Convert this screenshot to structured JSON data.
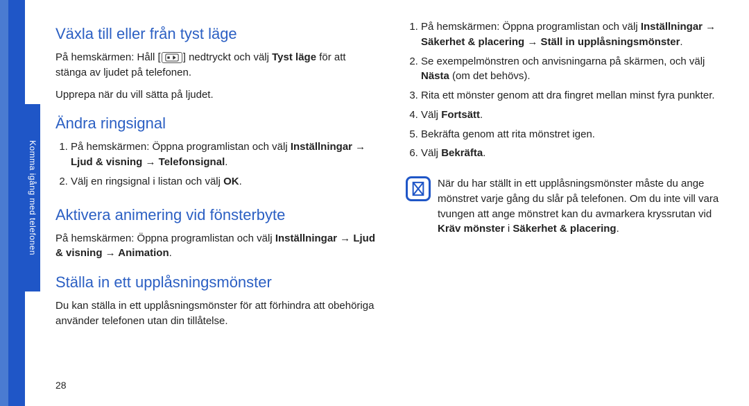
{
  "sidebar": {
    "label": "Komma igång med telefonen"
  },
  "page_number": "28",
  "col1": {
    "h1": "Växla till eller från tyst läge",
    "p1_a": "På hemskärmen: Håll [",
    "p1_b": "] nedtryckt och välj ",
    "p1_bold": "Tyst läge",
    "p1_c": " för att stänga av ljudet på telefonen.",
    "p2": "Upprepa när du vill sätta på ljudet.",
    "h2": "Ändra ringsignal",
    "li1_a": "På hemskärmen: Öppna programlistan och välj ",
    "li1_bold": "Inställningar → Ljud & visning → Telefonsignal",
    "li1_c": ".",
    "li2_a": "Välj en ringsignal i listan och välj ",
    "li2_bold": "OK",
    "li2_c": ".",
    "h3": "Aktivera animering vid fönsterbyte",
    "p3_a": "På hemskärmen: Öppna programlistan och välj ",
    "p3_bold": "Inställningar → Ljud & visning → Animation",
    "p3_c": ".",
    "h4": "Ställa in ett upplåsningsmönster",
    "p4": "Du kan ställa in ett upplåsningsmönster för att förhindra att obehöriga använder telefonen utan din tillåtelse."
  },
  "col2": {
    "li1_a": "På hemskärmen: Öppna programlistan och välj ",
    "li1_bold": "Inställningar → Säkerhet & placering → Ställ in upplåsningsmönster",
    "li1_c": ".",
    "li2_a": "Se exempelmönstren och anvisningarna på skärmen, och välj ",
    "li2_bold": "Nästa",
    "li2_c": " (om det behövs).",
    "li3": "Rita ett mönster genom att dra fingret mellan minst fyra punkter.",
    "li4_a": "Välj ",
    "li4_bold": "Fortsätt",
    "li4_c": ".",
    "li5": "Bekräfta genom att rita mönstret igen.",
    "li6_a": " Välj ",
    "li6_bold": "Bekräfta",
    "li6_c": ".",
    "note_a": "När du har ställt in ett upplåsningsmönster måste du ange mönstret varje gång du slår på telefonen. Om du inte vill vara tvungen att ange mönstret kan du avmarkera kryssrutan vid ",
    "note_bold1": "Kräv mönster",
    "note_b": " i ",
    "note_bold2": "Säkerhet & placering",
    "note_c": "."
  }
}
